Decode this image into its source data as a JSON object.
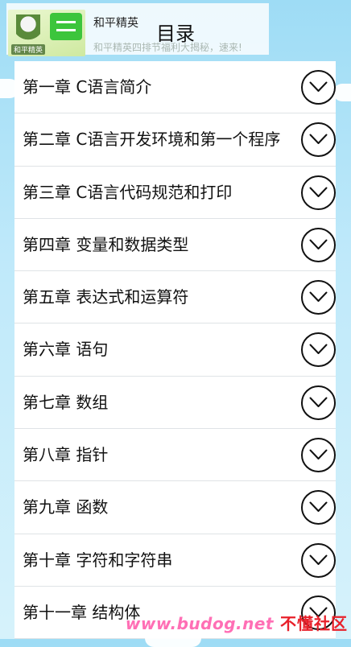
{
  "header": {
    "title": "目录"
  },
  "ad": {
    "title": "和平精英",
    "subtitle": "和平精英四排节福利大揭秘，速来!",
    "thumb_caption": "和平精英",
    "thumb_glyph": "三"
  },
  "chapters": [
    {
      "label": "第一章 C语言简介",
      "icon": "chevron-down-icon"
    },
    {
      "label": "第二章 C语言开发环境和第一个程序",
      "icon": "chevron-down-icon"
    },
    {
      "label": "第三章 C语言代码规范和打印",
      "icon": "chevron-down-icon"
    },
    {
      "label": "第四章 变量和数据类型",
      "icon": "chevron-down-icon"
    },
    {
      "label": "第五章 表达式和运算符",
      "icon": "chevron-down-icon"
    },
    {
      "label": "第六章 语句",
      "icon": "chevron-down-icon"
    },
    {
      "label": "第七章 数组",
      "icon": "chevron-down-icon"
    },
    {
      "label": "第八章 指针",
      "icon": "chevron-down-icon"
    },
    {
      "label": "第九章 函数",
      "icon": "chevron-down-icon"
    },
    {
      "label": "第十章 字符和字符串",
      "icon": "chevron-down-icon"
    },
    {
      "label": "第十一章 结构体",
      "icon": "chevron-down-icon"
    }
  ],
  "watermark": {
    "url": "www.budog.net",
    "brand": "不懂社区"
  },
  "colors": {
    "background_top": "#9edcf5",
    "list_background": "#ffffff",
    "divider": "#dfe3e6",
    "watermark_url": "#ff6fb5",
    "watermark_brand": "#e8202a"
  }
}
